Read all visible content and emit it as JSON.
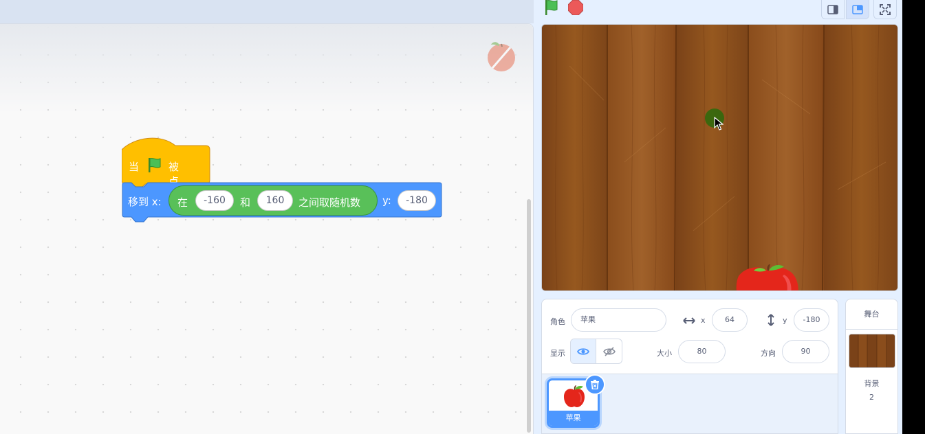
{
  "stage_controls": {
    "green_flag": "green-flag-icon",
    "stop": "stop-icon"
  },
  "layout_buttons": [
    "small-stage-icon",
    "large-stage-icon",
    "fullscreen-icon"
  ],
  "blocks": {
    "hat": {
      "prefix": "当",
      "suffix": "被点击",
      "color": "#ffbf00"
    },
    "motion": {
      "prefix": "移到 x:",
      "y_label": "y:",
      "y_value": "-180",
      "color": "#4c97ff"
    },
    "random": {
      "prefix": "在",
      "from": "-160",
      "and": "和",
      "to": "160",
      "suffix": "之间取随机数",
      "color": "#59c059"
    }
  },
  "sprite_info": {
    "sprite_label": "角色",
    "sprite_name": "苹果",
    "x_label": "x",
    "x_value": "64",
    "y_label": "y",
    "y_value": "-180",
    "show_label": "显示",
    "size_label": "大小",
    "size_value": "80",
    "direction_label": "方向",
    "direction_value": "90"
  },
  "sprite_list": [
    {
      "name": "苹果",
      "selected": true
    }
  ],
  "stage_pane": {
    "title": "舞台",
    "backdrop_label": "背景",
    "backdrop_count": "2"
  },
  "colors": {
    "accent": "#4c97ff",
    "wood": "#8a4f1e"
  }
}
